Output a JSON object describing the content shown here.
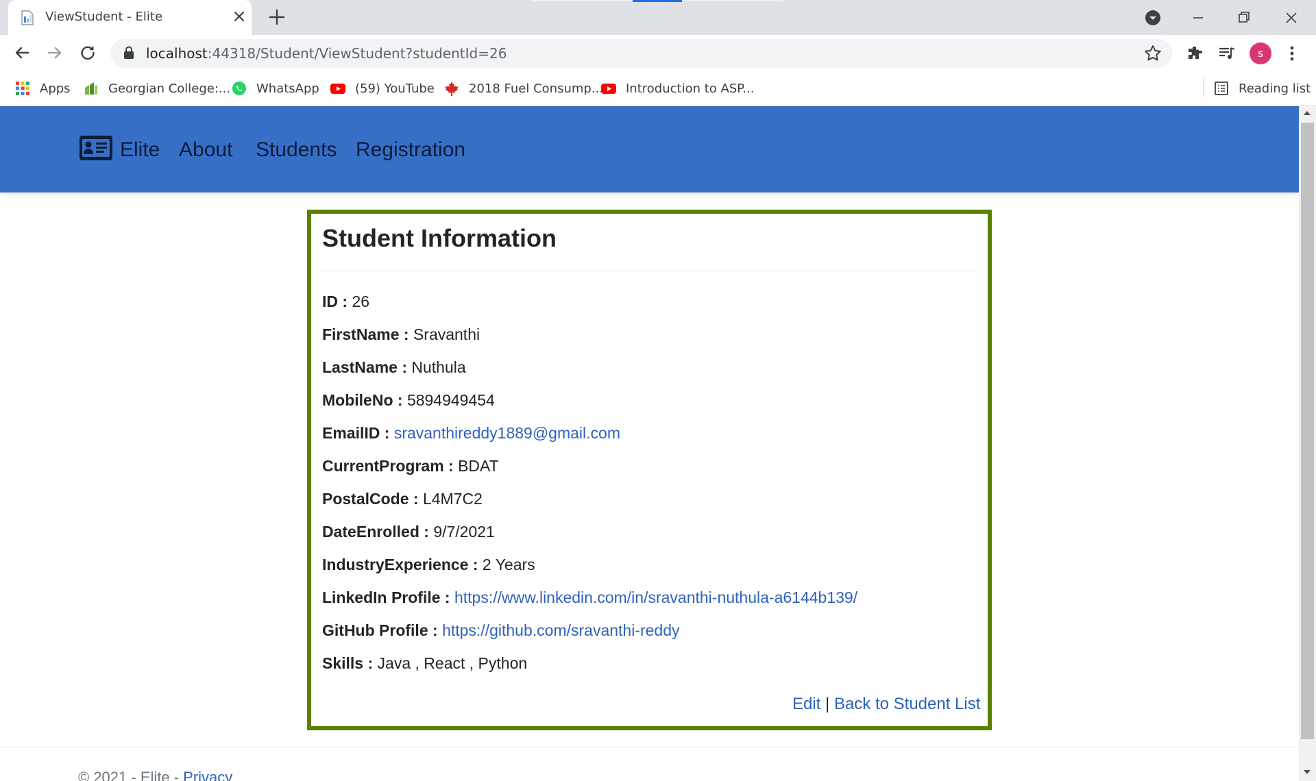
{
  "browser": {
    "tab": {
      "title": "ViewStudent - Elite"
    },
    "url": {
      "host": "localhost",
      "rest": ":44318/Student/ViewStudent?studentId=26"
    },
    "profile_initial": "s",
    "bookmarks": [
      {
        "label": "Apps",
        "icon": "apps-grid-icon"
      },
      {
        "label": "Georgian College:...",
        "icon": "georgian-college-icon"
      },
      {
        "label": "WhatsApp",
        "icon": "whatsapp-icon"
      },
      {
        "label": "(59) YouTube",
        "icon": "youtube-icon"
      },
      {
        "label": "2018 Fuel Consump...",
        "icon": "maple-leaf-icon"
      },
      {
        "label": "Introduction to ASP...",
        "icon": "youtube-icon"
      }
    ],
    "reading_list": "Reading list"
  },
  "site": {
    "brand": "Elite",
    "nav": [
      "About",
      "Students",
      "Registration"
    ],
    "nav_color": "#376fc7"
  },
  "student": {
    "title": "Student Information",
    "fields": [
      {
        "label": "ID :",
        "value": "26"
      },
      {
        "label": "FirstName :",
        "value": "Sravanthi"
      },
      {
        "label": "LastName :",
        "value": "Nuthula"
      },
      {
        "label": "MobileNo :",
        "value": "5894949454"
      },
      {
        "label": "EmailID :",
        "value": "sravanthireddy1889@gmail.com",
        "link": true
      },
      {
        "label": "CurrentProgram :",
        "value": "BDAT"
      },
      {
        "label": "PostalCode :",
        "value": "L4M7C2"
      },
      {
        "label": "DateEnrolled :",
        "value": "9/7/2021"
      },
      {
        "label": "IndustryExperience :",
        "value": "2 Years"
      },
      {
        "label": "LinkedIn Profile :",
        "value": "https://www.linkedin.com/in/sravanthi-nuthula-a6144b139/",
        "link": true
      },
      {
        "label": "GitHub Profile :",
        "value": "https://github.com/sravanthi-reddy",
        "link": true
      },
      {
        "label": "Skills :",
        "value": "Java , React , Python"
      }
    ],
    "edit_label": "Edit",
    "separator": "|",
    "back_label": "Back to Student List",
    "border_color": "#5a8000"
  },
  "footer": {
    "text": "© 2021 - Elite - ",
    "privacy": "Privacy"
  }
}
